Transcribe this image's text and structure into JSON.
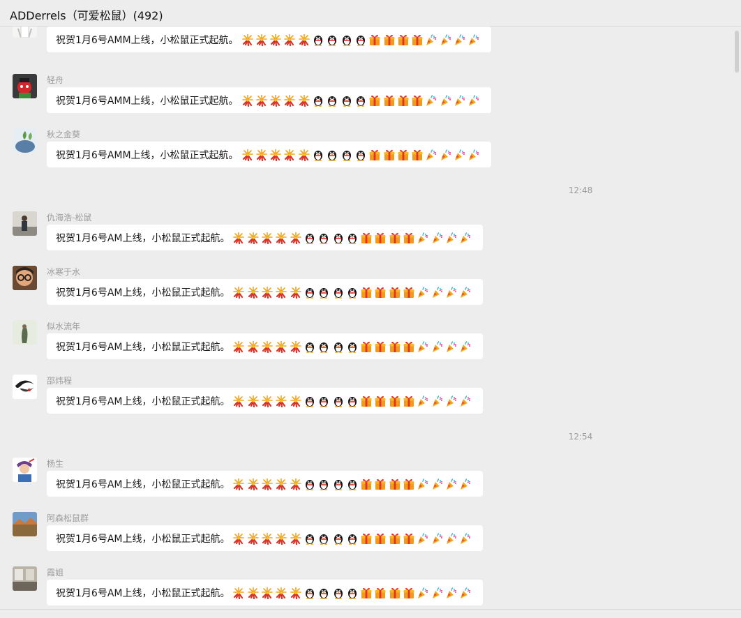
{
  "window": {
    "title": "ADDerrels（可爱松鼠）(492)"
  },
  "emoji_sequence": [
    "firecracker",
    "firecracker",
    "firecracker",
    "firecracker",
    "firecracker",
    "penguin",
    "penguin",
    "penguin",
    "penguin",
    "gift",
    "gift",
    "gift",
    "gift",
    "party-popper",
    "party-popper",
    "party-popper",
    "party-popper"
  ],
  "colors": {
    "background": "#ededed",
    "bubble": "#ffffff",
    "meta_text": "#9b9b9b"
  },
  "messages": [
    {
      "sender": "",
      "text": "祝贺1月6号AMM上线，小松鼠正式起航。"
    },
    {
      "sender": "轻舟",
      "text": "祝贺1月6号AMM上线，小松鼠正式起航。"
    },
    {
      "sender": "秋之金葵",
      "text": "祝贺1月6号AMM上线，小松鼠正式起航。"
    },
    {
      "timestamp": "12:48"
    },
    {
      "sender": "仇海浩-松鼠",
      "text": "祝贺1月6号AM上线，小松鼠正式起航。"
    },
    {
      "sender": "冰寒于水",
      "text": "祝贺1月6号AM上线，小松鼠正式起航。"
    },
    {
      "sender": "似水流年",
      "text": "祝贺1月6号AM上线，小松鼠正式起航。"
    },
    {
      "sender": "邵炜程",
      "text": "祝贺1月6号AM上线，小松鼠正式起航。"
    },
    {
      "timestamp": "12:54"
    },
    {
      "sender": "杨生",
      "text": "祝贺1月6号AM上线，小松鼠正式起航。"
    },
    {
      "sender": "阿森松鼠群",
      "text": "祝贺1月6号AM上线，小松鼠正式起航。"
    },
    {
      "sender": "霞姐",
      "text": "祝贺1月6号AM上线，小松鼠正式起航。"
    }
  ]
}
